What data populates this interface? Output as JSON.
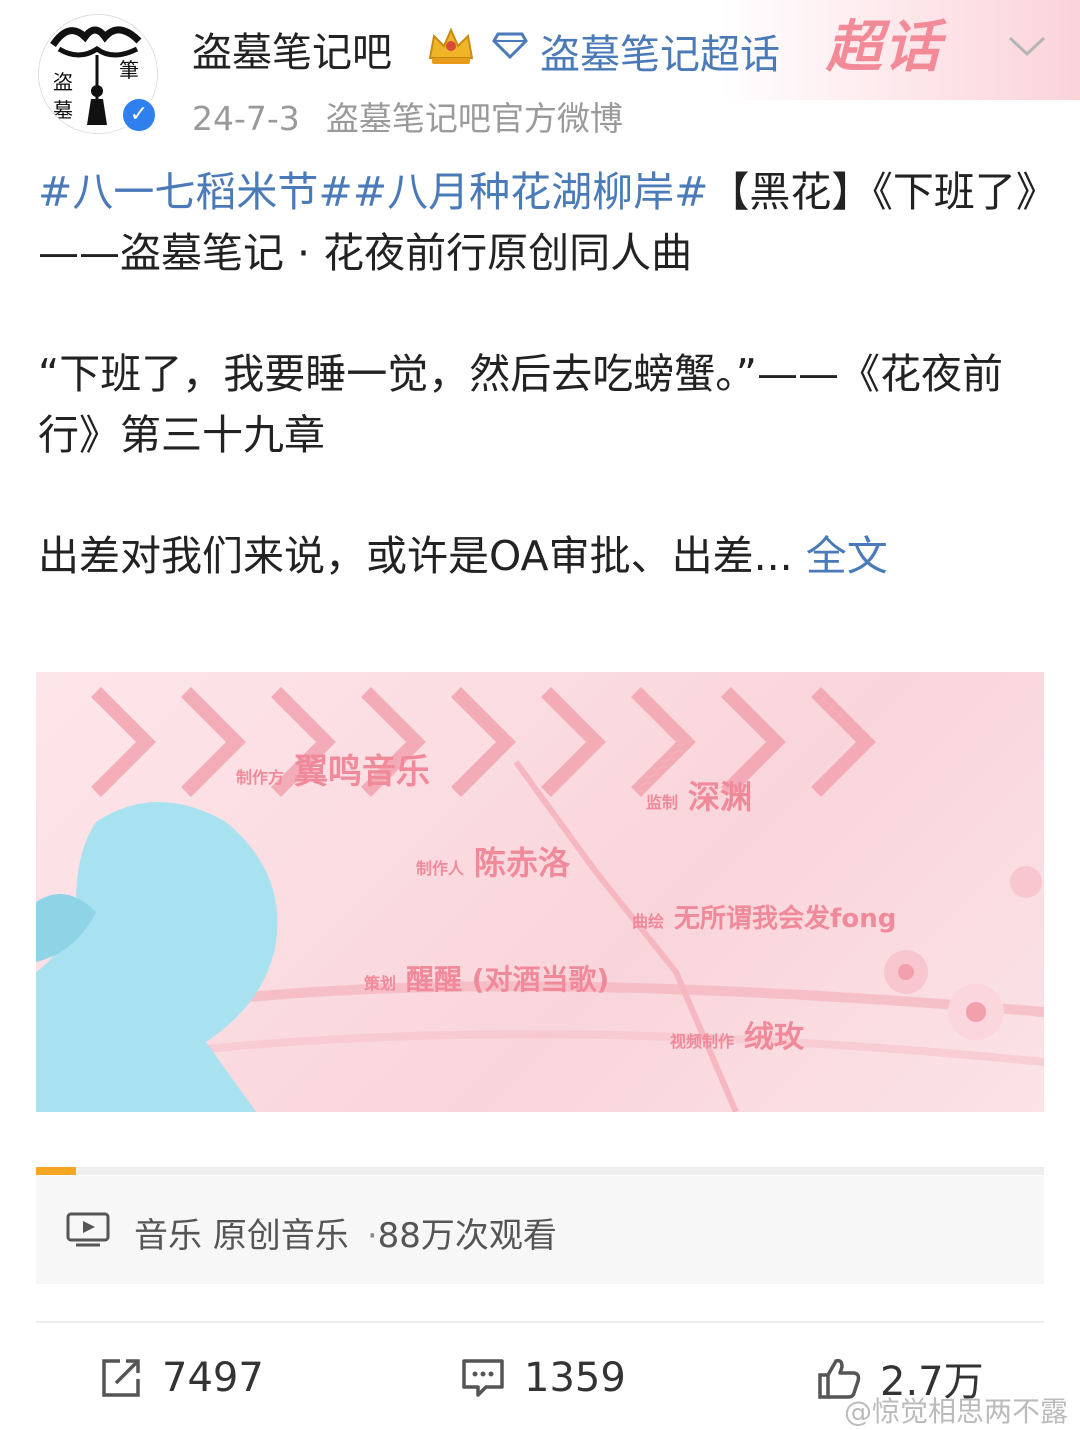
{
  "post": {
    "author": "盗墓笔记吧",
    "supertopic_link": "盗墓笔记超话",
    "supertopic_badge": "超话",
    "date": "24-7-3",
    "source": "盗墓笔记吧官方微博",
    "hashtag1": "#八一七稻米节#",
    "hashtag2": "#八月种花湖柳岸#",
    "title_rest": "【黑花】《下班了》——盗墓笔记 · 花夜前行原创同人曲",
    "quote": "“下班了，我要睡一觉，然后去吃螃蟹。”——《花夜前行》第三十九章",
    "excerpt": "出差对我们来说，或许是OA审批、出差...",
    "more_label": "全文",
    "avatar_text": "盗墓筆"
  },
  "video": {
    "credits": [
      {
        "role": "制作方",
        "name": "翼鸣音乐"
      },
      {
        "role": "监制",
        "name": "深渊"
      },
      {
        "role": "制作人",
        "name": "陈赤洛"
      },
      {
        "role": "曲绘",
        "name": "无所谓我会发fong"
      },
      {
        "role": "策划",
        "name": "醒醒 (对酒当歌)"
      },
      {
        "role": "视频制作",
        "name": "绒玫"
      }
    ],
    "progress": 0.04,
    "category": "音乐",
    "subcategory": "原创音乐",
    "separator": "·",
    "views": "88万次观看"
  },
  "actions": {
    "share_count": "7497",
    "comment_count": "1359",
    "like_count": "2.7万"
  },
  "watermark": "@惊觉相思两不露",
  "colors": {
    "link": "#4a7ab8",
    "progress": "#f5a623",
    "badge": "#f38a98"
  }
}
